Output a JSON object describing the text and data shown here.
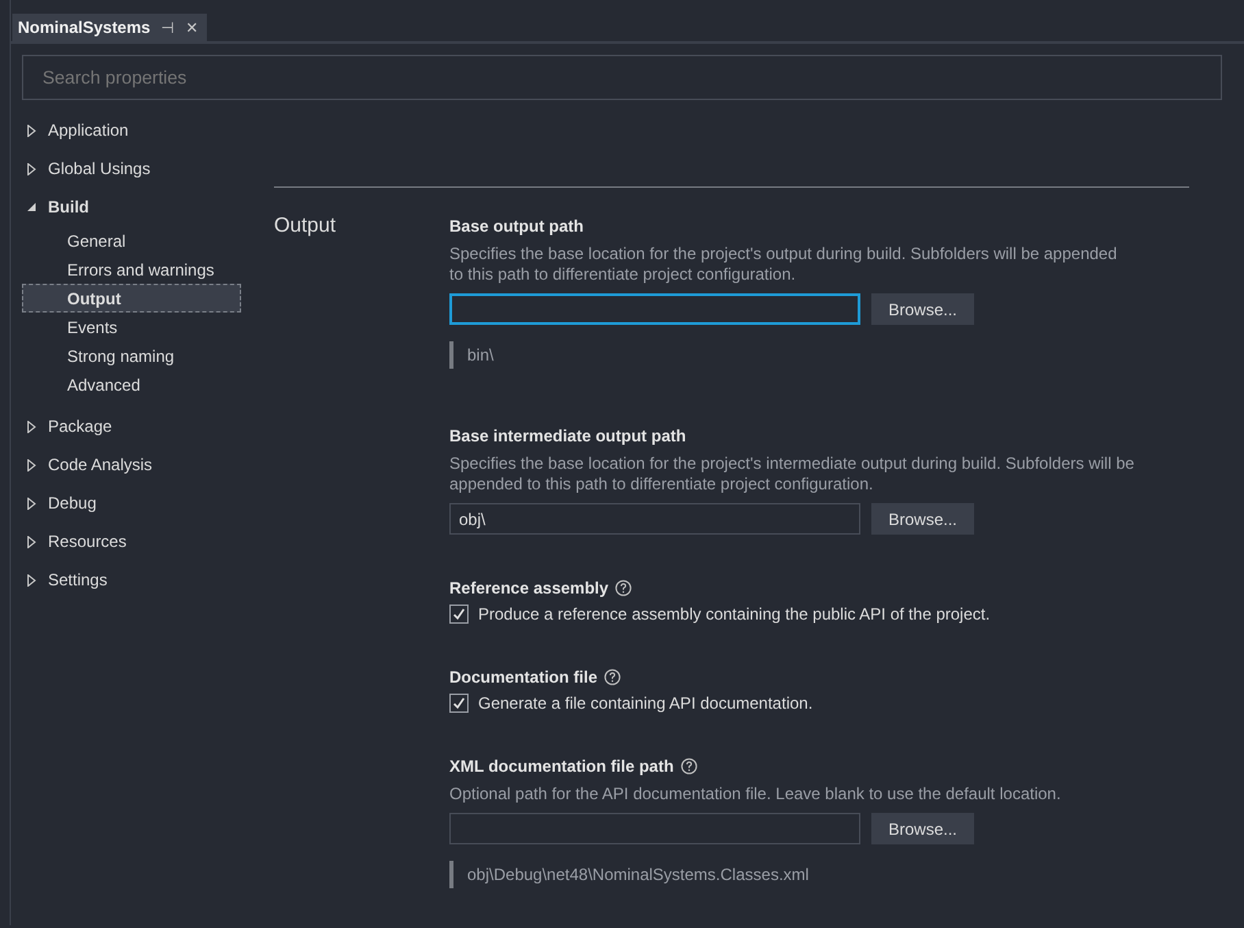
{
  "tab": {
    "title": "NominalSystems",
    "pin_glyph": "⊣",
    "close_glyph": "✕"
  },
  "search": {
    "placeholder": "Search properties"
  },
  "sidebar": {
    "items": [
      {
        "label": "Application",
        "expanded": false
      },
      {
        "label": "Global Usings",
        "expanded": false
      },
      {
        "label": "Build",
        "expanded": true,
        "children": [
          {
            "label": "General",
            "selected": false
          },
          {
            "label": "Errors and warnings",
            "selected": false
          },
          {
            "label": "Output",
            "selected": true
          },
          {
            "label": "Events",
            "selected": false
          },
          {
            "label": "Strong naming",
            "selected": false
          },
          {
            "label": "Advanced",
            "selected": false
          }
        ]
      },
      {
        "label": "Package",
        "expanded": false
      },
      {
        "label": "Code Analysis",
        "expanded": false
      },
      {
        "label": "Debug",
        "expanded": false
      },
      {
        "label": "Resources",
        "expanded": false
      },
      {
        "label": "Settings",
        "expanded": false
      }
    ]
  },
  "section": {
    "title": "Output"
  },
  "settings": [
    {
      "kind": "path",
      "label": "Base output path",
      "description": "Specifies the base location for the project's output during build. Subfolders will be appended to this path to differentiate project configuration.",
      "focused": true,
      "button": "Browse...",
      "preview": "bin\\"
    },
    {
      "kind": "path",
      "label": "Base intermediate output path",
      "description": "Specifies the base location for the project's intermediate output during build. Subfolders will be appended to this path to differentiate project configuration.",
      "value": "obj\\",
      "focused": false,
      "button": "Browse..."
    },
    {
      "kind": "check",
      "label": "Reference assembly",
      "help": true,
      "checked": true,
      "text": "Produce a reference assembly containing the public API of the project."
    },
    {
      "kind": "check",
      "label": "Documentation file",
      "help": true,
      "checked": true,
      "text": "Generate a file containing API documentation."
    },
    {
      "kind": "path",
      "label": "XML documentation file path",
      "help": true,
      "description": "Optional path for the API documentation file. Leave blank to use the default location.",
      "focused": false,
      "button": "Browse...",
      "preview": "obj\\Debug\\net48\\NominalSystems.Classes.xml"
    }
  ]
}
